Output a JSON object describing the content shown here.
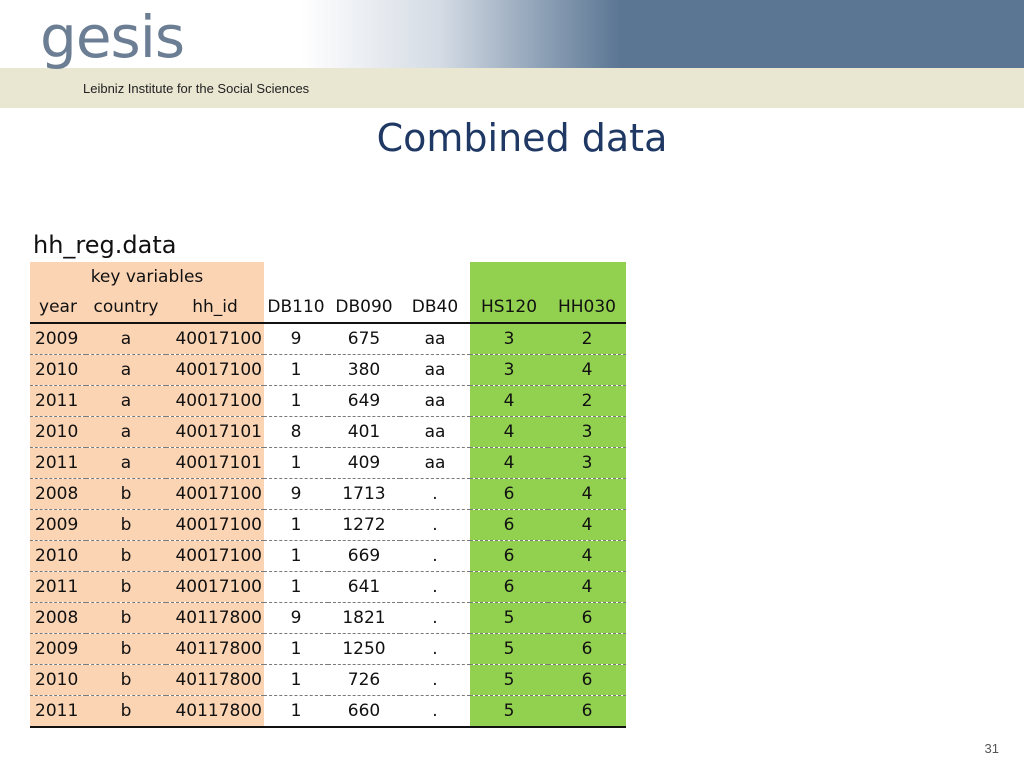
{
  "header": {
    "logo_word": "gesis",
    "logo_subtitle": "Leibniz Institute for the Social Sciences",
    "banner_color": "#5b7693",
    "band_color": "#e9e6d2"
  },
  "slide": {
    "title": "Combined data",
    "page_number": "31"
  },
  "table": {
    "name": "hh_reg.data",
    "group_label": "key variables",
    "key_color": "#fbd4b4",
    "added_color": "#92d050",
    "columns": [
      "year",
      "country",
      "hh_id",
      "DB110",
      "DB090",
      "DB40",
      "HS120",
      "HH030"
    ],
    "rows": [
      [
        "2009",
        "a",
        "40017100",
        "9",
        "675",
        "aa",
        "3",
        "2"
      ],
      [
        "2010",
        "a",
        "40017100",
        "1",
        "380",
        "aa",
        "3",
        "4"
      ],
      [
        "2011",
        "a",
        "40017100",
        "1",
        "649",
        "aa",
        "4",
        "2"
      ],
      [
        "2010",
        "a",
        "40017101",
        "8",
        "401",
        "aa",
        "4",
        "3"
      ],
      [
        "2011",
        "a",
        "40017101",
        "1",
        "409",
        "aa",
        "4",
        "3"
      ],
      [
        "2008",
        "b",
        "40017100",
        "9",
        "1713",
        ".",
        "6",
        "4"
      ],
      [
        "2009",
        "b",
        "40017100",
        "1",
        "1272",
        ".",
        "6",
        "4"
      ],
      [
        "2010",
        "b",
        "40017100",
        "1",
        "669",
        ".",
        "6",
        "4"
      ],
      [
        "2011",
        "b",
        "40017100",
        "1",
        "641",
        ".",
        "6",
        "4"
      ],
      [
        "2008",
        "b",
        "40117800",
        "9",
        "1821",
        ".",
        "5",
        "6"
      ],
      [
        "2009",
        "b",
        "40117800",
        "1",
        "1250",
        ".",
        "5",
        "6"
      ],
      [
        "2010",
        "b",
        "40117800",
        "1",
        "726",
        ".",
        "5",
        "6"
      ],
      [
        "2011",
        "b",
        "40117800",
        "1",
        "660",
        ".",
        "5",
        "6"
      ]
    ]
  }
}
